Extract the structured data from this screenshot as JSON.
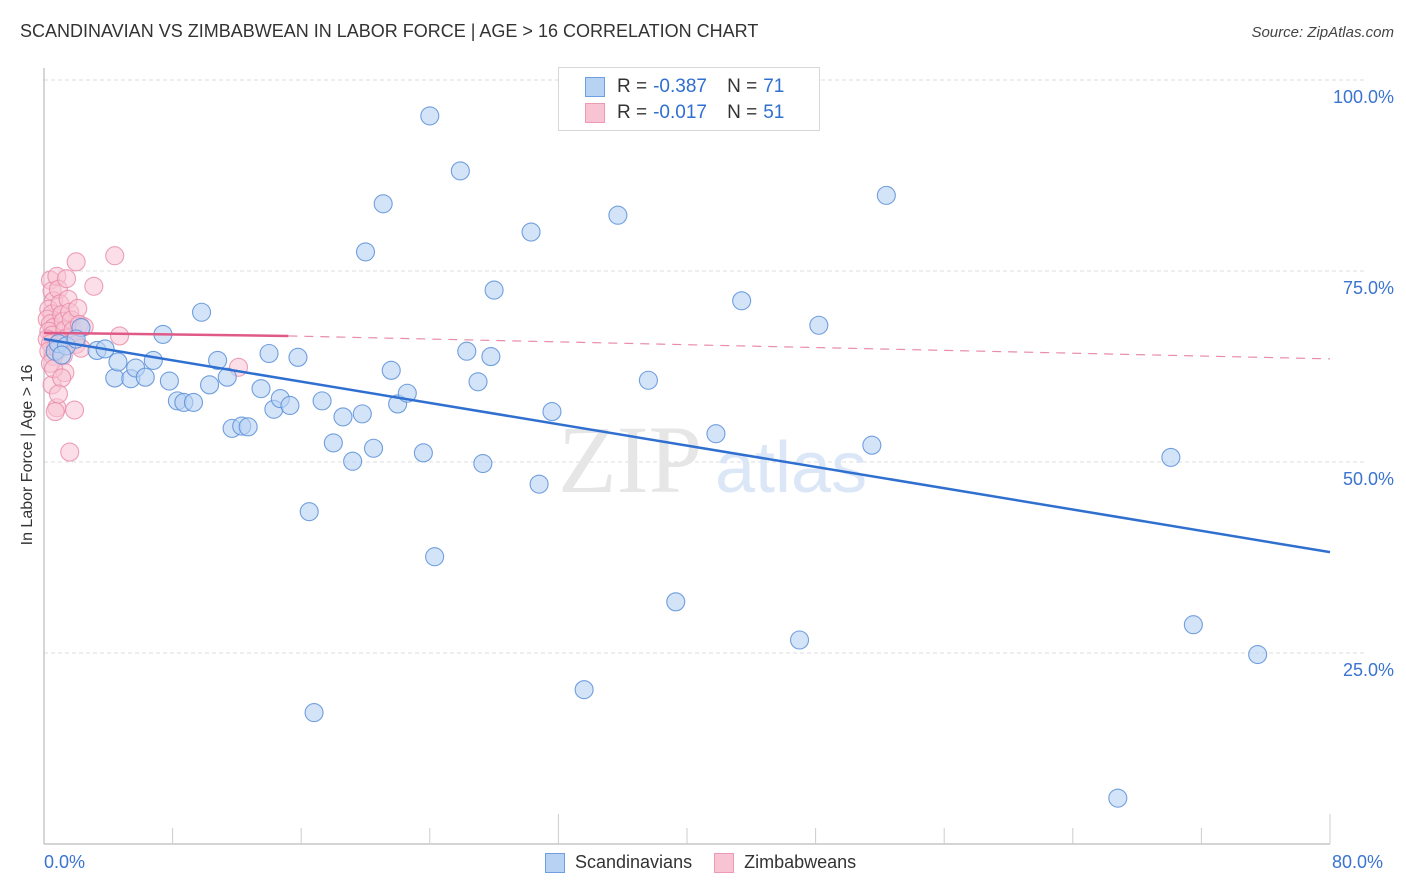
{
  "header": {
    "title": "SCANDINAVIAN VS ZIMBABWEAN IN LABOR FORCE | AGE > 16 CORRELATION CHART",
    "source": "Source: ZipAtlas.com"
  },
  "legend": {
    "rows": [
      {
        "r_label": "R =",
        "r_value": "-0.387",
        "n_label": "N =",
        "n_value": "71"
      },
      {
        "r_label": "R =",
        "r_value": "-0.017",
        "n_label": "N =",
        "n_value": "51"
      }
    ],
    "bottom": [
      {
        "label": "Scandinavians"
      },
      {
        "label": "Zimbabweans"
      }
    ]
  },
  "watermark": {
    "part1": "ZIP",
    "part2": "atlas"
  },
  "colors": {
    "scandinavian_fill": "#b8d2f3",
    "scandinavian_stroke": "#5b8fd8",
    "scandinavian_line": "#2f6fd0",
    "zimbabwean_fill": "#f8c3d3",
    "zimbabwean_stroke": "#e88aa8",
    "zimbabwean_line": "#e05a88",
    "tick_label": "#3a74d0"
  },
  "chart_data": {
    "type": "scatter",
    "title": "SCANDINAVIAN VS ZIMBABWEAN IN LABOR FORCE | AGE > 16 CORRELATION CHART",
    "xlabel": "",
    "ylabel": "In Labor Force | Age > 16",
    "xlim": [
      0,
      80
    ],
    "ylim": [
      0,
      100
    ],
    "x_tick_labels": [
      "0.0%",
      "80.0%"
    ],
    "y_ticks": [
      25,
      50,
      75,
      100
    ],
    "y_tick_labels": [
      "25.0%",
      "50.0%",
      "75.0%",
      "100.0%"
    ],
    "grid": true,
    "legend_position": "top-center",
    "series": [
      {
        "name": "Scandinavians",
        "r": -0.387,
        "n": 71,
        "trend": {
          "x": [
            0,
            80
          ],
          "y": [
            66.1,
            38.2
          ],
          "style": "solid"
        },
        "points": [
          [
            0.7,
            64.5
          ],
          [
            0.9,
            65.5
          ],
          [
            1.4,
            65.2
          ],
          [
            2.3,
            67.6
          ],
          [
            2.0,
            66.1
          ],
          [
            3.3,
            64.6
          ],
          [
            3.8,
            64.8
          ],
          [
            4.4,
            61.0
          ],
          [
            4.6,
            63.1
          ],
          [
            5.4,
            60.9
          ],
          [
            5.7,
            62.3
          ],
          [
            6.3,
            61.1
          ],
          [
            6.8,
            63.3
          ],
          [
            7.4,
            66.7
          ],
          [
            7.8,
            60.6
          ],
          [
            8.3,
            58.0
          ],
          [
            8.7,
            57.8
          ],
          [
            9.3,
            57.8
          ],
          [
            9.8,
            69.6
          ],
          [
            10.3,
            60.1
          ],
          [
            10.8,
            63.3
          ],
          [
            11.4,
            61.1
          ],
          [
            11.7,
            54.4
          ],
          [
            12.3,
            54.7
          ],
          [
            12.7,
            54.6
          ],
          [
            13.5,
            59.6
          ],
          [
            14.0,
            64.2
          ],
          [
            14.3,
            56.9
          ],
          [
            14.7,
            58.3
          ],
          [
            15.3,
            57.4
          ],
          [
            15.8,
            63.7
          ],
          [
            16.5,
            43.5
          ],
          [
            16.8,
            17.2
          ],
          [
            17.3,
            58.0
          ],
          [
            18.0,
            52.5
          ],
          [
            18.6,
            55.9
          ],
          [
            19.2,
            50.1
          ],
          [
            19.8,
            56.3
          ],
          [
            20.0,
            77.5
          ],
          [
            20.5,
            51.8
          ],
          [
            21.1,
            83.8
          ],
          [
            21.6,
            62.0
          ],
          [
            22.0,
            57.6
          ],
          [
            22.6,
            59.0
          ],
          [
            23.6,
            51.2
          ],
          [
            24.0,
            95.3
          ],
          [
            24.3,
            37.6
          ],
          [
            25.9,
            88.1
          ],
          [
            26.3,
            64.5
          ],
          [
            27.0,
            60.5
          ],
          [
            27.3,
            49.8
          ],
          [
            27.8,
            63.8
          ],
          [
            28.0,
            72.5
          ],
          [
            30.3,
            80.1
          ],
          [
            30.8,
            47.1
          ],
          [
            31.6,
            56.6
          ],
          [
            33.6,
            20.2
          ],
          [
            35.7,
            82.3
          ],
          [
            37.6,
            60.7
          ],
          [
            39.3,
            31.7
          ],
          [
            41.8,
            53.7
          ],
          [
            43.4,
            71.1
          ],
          [
            47.0,
            26.7
          ],
          [
            48.2,
            67.9
          ],
          [
            51.5,
            52.2
          ],
          [
            52.4,
            84.9
          ],
          [
            66.8,
            6.0
          ],
          [
            70.1,
            50.6
          ],
          [
            71.5,
            28.7
          ],
          [
            75.5,
            24.8
          ],
          [
            1.1,
            64.0
          ]
        ]
      },
      {
        "name": "Zimbabweans",
        "r": -0.017,
        "n": 51,
        "trend": {
          "x": [
            0,
            15.2,
            80
          ],
          "y": [
            66.9,
            66.5,
            63.5
          ],
          "style": "solid-then-dashed"
        },
        "points": [
          [
            0.4,
            73.8
          ],
          [
            0.5,
            72.4
          ],
          [
            0.6,
            71.1
          ],
          [
            0.3,
            70.0
          ],
          [
            0.5,
            69.4
          ],
          [
            0.2,
            68.7
          ],
          [
            0.4,
            68.1
          ],
          [
            0.6,
            67.6
          ],
          [
            0.3,
            67.1
          ],
          [
            0.5,
            66.6
          ],
          [
            0.2,
            66.1
          ],
          [
            0.4,
            65.5
          ],
          [
            0.7,
            65.0
          ],
          [
            0.3,
            64.5
          ],
          [
            0.6,
            63.8
          ],
          [
            0.4,
            62.9
          ],
          [
            0.5,
            60.1
          ],
          [
            0.8,
            74.3
          ],
          [
            0.9,
            72.6
          ],
          [
            1.0,
            70.7
          ],
          [
            1.1,
            69.3
          ],
          [
            1.2,
            68.4
          ],
          [
            1.3,
            67.3
          ],
          [
            1.4,
            66.2
          ],
          [
            1.0,
            65.7
          ],
          [
            0.9,
            64.7
          ],
          [
            1.2,
            63.9
          ],
          [
            1.5,
            71.3
          ],
          [
            1.6,
            69.6
          ],
          [
            1.7,
            68.6
          ],
          [
            1.8,
            67.2
          ],
          [
            1.9,
            66.0
          ],
          [
            2.0,
            65.4
          ],
          [
            2.1,
            70.1
          ],
          [
            2.2,
            68.0
          ],
          [
            1.3,
            61.7
          ],
          [
            0.8,
            57.1
          ],
          [
            0.7,
            56.6
          ],
          [
            1.9,
            56.8
          ],
          [
            1.6,
            51.3
          ],
          [
            2.0,
            76.2
          ],
          [
            3.1,
            73.0
          ],
          [
            4.4,
            77.0
          ],
          [
            4.7,
            66.5
          ],
          [
            12.1,
            62.4
          ],
          [
            0.6,
            62.2
          ],
          [
            1.1,
            61.0
          ],
          [
            2.5,
            67.7
          ],
          [
            1.4,
            74.0
          ],
          [
            0.9,
            58.9
          ],
          [
            2.3,
            64.9
          ]
        ]
      }
    ]
  }
}
